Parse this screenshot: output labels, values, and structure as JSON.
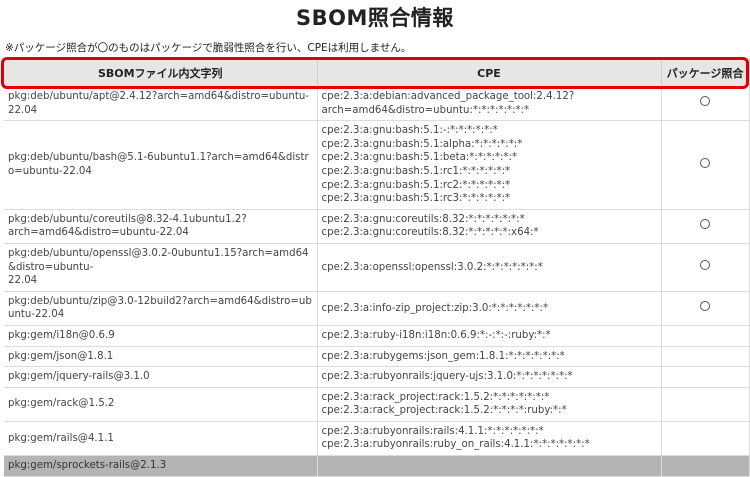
{
  "page": {
    "title": "SBOM照合情報",
    "note": "※パッケージ照合が〇のものはパッケージで脆弱性照合を行い、CPEは利用しません。"
  },
  "table": {
    "headers": [
      "SBOMファイル内文字列",
      "CPE",
      "パッケージ照合"
    ],
    "rows": [
      {
        "sbom": "pkg:deb/ubuntu/apt@2.4.12?arch=amd64&distro=ubuntu-22.04",
        "cpe": "cpe:2.3:a:debian:advanced_package_tool:2.4.12?\narch=amd64&distro=ubuntu:*:*:*:*:*:*:*",
        "match": "〇"
      },
      {
        "sbom": "pkg:deb/ubuntu/bash@5.1-6ubuntu1.1?arch=amd64&distro=ubuntu-22.04",
        "cpe": "cpe:2.3:a:gnu:bash:5.1:-:*:*:*:*:*:*\ncpe:2.3:a:gnu:bash:5.1:alpha:*:*:*:*:*:*\ncpe:2.3:a:gnu:bash:5.1:beta:*:*:*:*:*:*\ncpe:2.3:a:gnu:bash:5.1:rc1:*:*:*:*:*:*\ncpe:2.3:a:gnu:bash:5.1:rc2:*:*:*:*:*:*\ncpe:2.3:a:gnu:bash:5.1:rc3:*:*:*:*:*:*",
        "match": "〇"
      },
      {
        "sbom": "pkg:deb/ubuntu/coreutils@8.32-4.1ubuntu1.2?\narch=amd64&distro=ubuntu-22.04",
        "cpe": "cpe:2.3:a:gnu:coreutils:8.32:*:*:*:*:*:*:*\ncpe:2.3:a:gnu:coreutils:8.32:*:*:*:*:*:x64:*",
        "match": "〇"
      },
      {
        "sbom": "pkg:deb/ubuntu/openssl@3.0.2-0ubuntu1.15?arch=amd64&distro=ubuntu-\n22.04",
        "cpe": "cpe:2.3:a:openssl:openssl:3.0.2:*:*:*:*:*:*:*",
        "match": "〇"
      },
      {
        "sbom": "pkg:deb/ubuntu/zip@3.0-12build2?arch=amd64&distro=ubuntu-22.04",
        "cpe": "cpe:2.3:a:info-zip_project:zip:3.0:*:*:*:*:*:*:*",
        "match": "〇"
      },
      {
        "sbom": "pkg:gem/i18n@0.6.9",
        "cpe": "cpe:2.3:a:ruby-i18n:i18n:0.6.9:*:-:*:-:ruby:*:*",
        "match": ""
      },
      {
        "sbom": "pkg:gem/json@1.8.1",
        "cpe": "cpe:2.3:a:rubygems:json_gem:1.8.1:*:*:*:*:*:*:*",
        "match": ""
      },
      {
        "sbom": "pkg:gem/jquery-rails@3.1.0",
        "cpe": "cpe:2.3:a:rubyonrails:jquery-ujs:3.1.0:*:*:*:*:*:*:*",
        "match": ""
      },
      {
        "sbom": "pkg:gem/rack@1.5.2",
        "cpe": "cpe:2.3:a:rack_project:rack:1.5.2:*:*:*:*:*:*:*\ncpe:2.3:a:rack_project:rack:1.5.2:*:*:*:*:ruby:*:*",
        "match": ""
      },
      {
        "sbom": "pkg:gem/rails@4.1.1",
        "cpe": "cpe:2.3:a:rubyonrails:rails:4.1.1:*:*:*:*:*:*:*\ncpe:2.3:a:rubyonrails:ruby_on_rails:4.1.1:*:*:*:*:*:*:*",
        "match": ""
      },
      {
        "sbom": "pkg:gem/sprockets-rails@2.1.3",
        "cpe": "",
        "match": ""
      }
    ]
  },
  "colors": {
    "highlight_border": "#e00000",
    "header_bg": "#e6e6e6",
    "selected_row_bg": "#b4b4b4"
  }
}
